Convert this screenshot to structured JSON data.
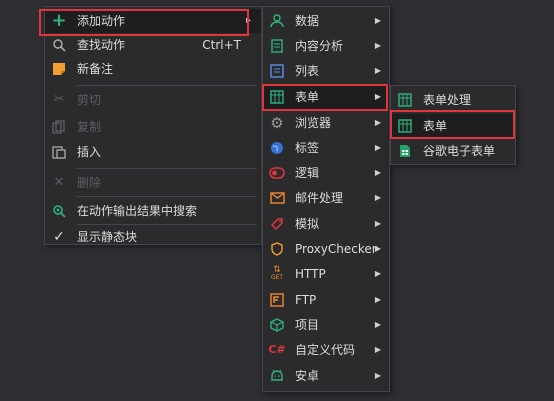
{
  "main_menu": {
    "items": [
      {
        "label": "添加动作"
      },
      {
        "label": "查找动作",
        "shortcut": "Ctrl+T"
      },
      {
        "label": "新备注"
      },
      {
        "label": "剪切"
      },
      {
        "label": "复制"
      },
      {
        "label": "插入"
      },
      {
        "label": "删除"
      },
      {
        "label": "在动作输出结果中搜索"
      },
      {
        "label": "显示静态块"
      }
    ]
  },
  "submenu": {
    "items": [
      {
        "label": "数据"
      },
      {
        "label": "内容分析"
      },
      {
        "label": "列表"
      },
      {
        "label": "表单"
      },
      {
        "label": "浏览器"
      },
      {
        "label": "标签"
      },
      {
        "label": "逻辑"
      },
      {
        "label": "邮件处理"
      },
      {
        "label": "模拟"
      },
      {
        "label": "ProxyChecker"
      },
      {
        "label": "HTTP"
      },
      {
        "label": "FTP"
      },
      {
        "label": "项目"
      },
      {
        "label": "自定义代码"
      },
      {
        "label": "安卓"
      }
    ],
    "http_icon_text": "GET",
    "csharp_icon_text": "C#"
  },
  "form_menu": {
    "items": [
      {
        "label": "表单处理"
      },
      {
        "label": "表单"
      },
      {
        "label": "谷歌电子表单"
      }
    ]
  },
  "colors": {
    "menu_bg": "#2b2b2e",
    "highlight": "#e0353b",
    "accent_green": "#2fb37a"
  }
}
